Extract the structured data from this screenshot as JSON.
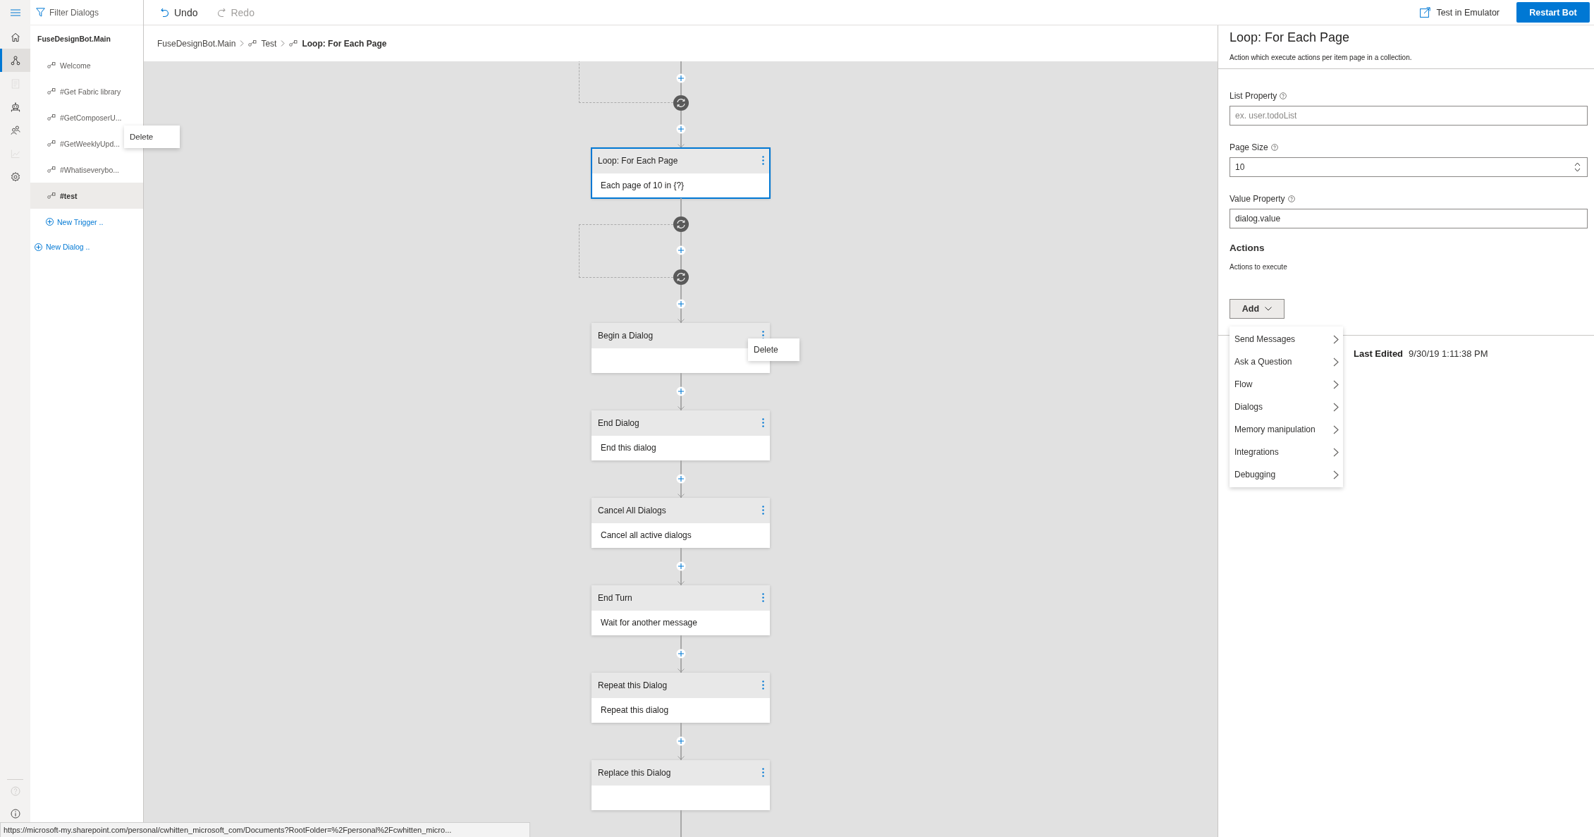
{
  "nav_rail": {
    "items": [
      {
        "selected": false,
        "disabled": false
      },
      {
        "selected": true,
        "disabled": false
      },
      {
        "selected": false,
        "disabled": true
      },
      {
        "selected": false,
        "disabled": false
      },
      {
        "selected": false,
        "disabled": false
      },
      {
        "selected": false,
        "disabled": true
      },
      {
        "selected": false,
        "disabled": false
      }
    ],
    "bottom": [
      {
        "disabled": true
      },
      {
        "disabled": false
      }
    ]
  },
  "sidebar": {
    "filter": {
      "placeholder": "Filter Dialogs"
    },
    "dialog": "FuseDesignBot.Main",
    "triggers": [
      {
        "label": "Welcome",
        "selected": false
      },
      {
        "label": "#Get Fabric library",
        "selected": false
      },
      {
        "label": "#GetComposerU...",
        "selected": false
      },
      {
        "label": "#GetWeeklyUpd...",
        "selected": false
      },
      {
        "label": "#Whatiseverybo...",
        "selected": false
      },
      {
        "label": "#test",
        "selected": true
      }
    ],
    "new_trigger": "New Trigger ..",
    "new_dialog": "New Dialog ..",
    "context_menu": {
      "items": [
        "Delete"
      ]
    }
  },
  "toolbar": {
    "undo": {
      "label": "Undo",
      "disabled": false
    },
    "redo": {
      "label": "Redo",
      "disabled": true
    },
    "test": "Test in Emulator",
    "restart": "Restart Bot"
  },
  "breadcrumb": [
    {
      "label": "FuseDesignBot.Main",
      "kind": "dialog",
      "selected": false
    },
    {
      "label": "Test",
      "kind": "trigger",
      "selected": false
    },
    {
      "label": "Loop: For Each Page",
      "kind": "trigger",
      "selected": true
    }
  ],
  "canvas": {
    "flow": [
      {
        "kind": "loop_end"
      },
      {
        "kind": "loop",
        "title": "Loop: For Each Page",
        "body": "Each page of 10 in {?}",
        "selected": true
      },
      {
        "kind": "action",
        "title": "Begin a Dialog",
        "selected": false,
        "context_menu": {
          "items": [
            "Delete"
          ]
        }
      },
      {
        "kind": "action",
        "title": "End Dialog",
        "body": "End this dialog",
        "selected": false
      },
      {
        "kind": "action",
        "title": "Cancel All Dialogs",
        "body": "Cancel all active dialogs",
        "selected": false
      },
      {
        "kind": "action",
        "title": "End Turn",
        "body": "Wait for another message",
        "selected": false
      },
      {
        "kind": "action",
        "title": "Repeat this Dialog",
        "body": "Repeat this dialog",
        "selected": false
      },
      {
        "kind": "action",
        "title": "Replace this Dialog",
        "selected": false
      }
    ]
  },
  "properties": {
    "title": "Loop: For Each Page",
    "description": "Action which execute actions per item page in a collection.",
    "fields": [
      {
        "label": "List Property",
        "kind": "text",
        "placeholder": "ex. user.todoList"
      },
      {
        "label": "Page Size",
        "kind": "number",
        "value": "10"
      },
      {
        "label": "Value Property",
        "kind": "text",
        "value": "dialog.value"
      }
    ],
    "actions": {
      "heading": "Actions",
      "description": "Actions to execute",
      "add_button": {
        "label": "Add",
        "expanded": true
      },
      "menu": [
        "Send Messages",
        "Ask a Question",
        "Flow",
        "Dialogs",
        "Memory manipulation",
        "Integrations",
        "Debugging"
      ]
    },
    "last_edited": {
      "label": "Last Edited",
      "value": "9/30/19 1:11:38 PM"
    }
  },
  "status_url": "https://microsoft-my.sharepoint.com/personal/cwhitten_microsoft_com/Documents?RootFolder=%2Fpersonal%2Fcwhitten_micro..."
}
